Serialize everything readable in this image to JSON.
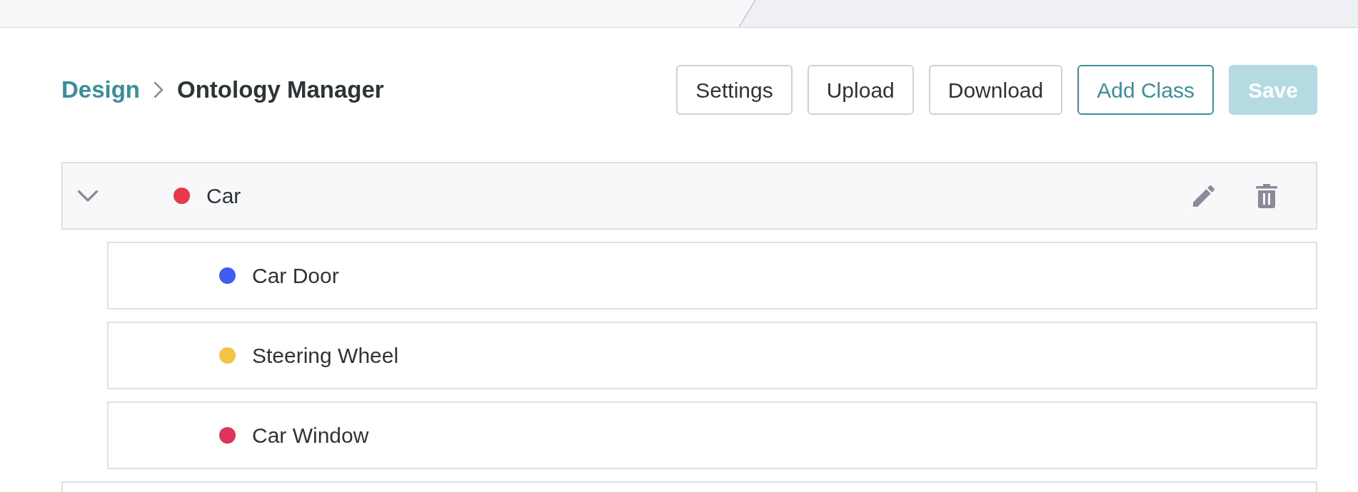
{
  "breadcrumb": [
    {
      "label": "Design",
      "kind": "link"
    },
    {
      "label": "Ontology Manager",
      "kind": "current"
    }
  ],
  "toolbar": [
    {
      "label": "Settings",
      "kind": "outline",
      "disabled": false
    },
    {
      "label": "Upload",
      "kind": "outline",
      "disabled": false
    },
    {
      "label": "Download",
      "kind": "outline",
      "disabled": false
    },
    {
      "label": "Add Class",
      "kind": "accent-outline",
      "disabled": false
    },
    {
      "label": "Save",
      "kind": "accent",
      "disabled": true
    }
  ],
  "classes": [
    {
      "label": "Car",
      "color": "#e8394a",
      "expanded": true,
      "highlighted": true,
      "children": [
        {
          "label": "Car Door",
          "color": "#3d5ef5",
          "highlighted": false
        },
        {
          "label": "Steering Wheel",
          "color": "#f6c445",
          "highlighted": false
        },
        {
          "label": "Car Window",
          "color": "#e0325a",
          "highlighted": false
        }
      ]
    }
  ]
}
